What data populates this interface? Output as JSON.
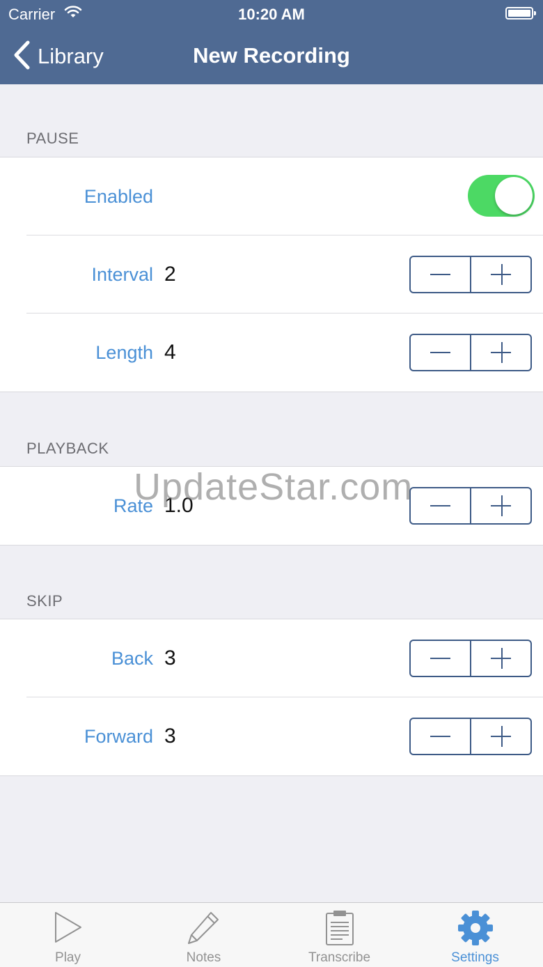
{
  "colors": {
    "accent": "#4f6a93",
    "label_blue": "#4a90d6",
    "toggle_on": "#4cd964",
    "stepper": "#3d5a86"
  },
  "status_bar": {
    "carrier": "Carrier",
    "time": "10:20 AM"
  },
  "nav": {
    "back_label": "Library",
    "title": "New Recording"
  },
  "sections": {
    "pause": {
      "header": "PAUSE",
      "enabled_label": "Enabled",
      "enabled": true,
      "interval_label": "Interval",
      "interval_value": "2",
      "length_label": "Length",
      "length_value": "4"
    },
    "playback": {
      "header": "PLAYBACK",
      "rate_label": "Rate",
      "rate_value": "1.0"
    },
    "skip": {
      "header": "SKIP",
      "back_label": "Back",
      "back_value": "3",
      "forward_label": "Forward",
      "forward_value": "3"
    }
  },
  "watermark": "UpdateStar.com",
  "tabs": [
    {
      "label": "Play",
      "icon": "play-icon",
      "active": false
    },
    {
      "label": "Notes",
      "icon": "pencil-icon",
      "active": false
    },
    {
      "label": "Transcribe",
      "icon": "clipboard-icon",
      "active": false
    },
    {
      "label": "Settings",
      "icon": "gear-icon",
      "active": true
    }
  ]
}
